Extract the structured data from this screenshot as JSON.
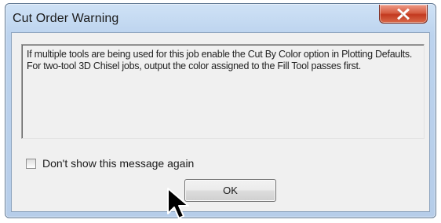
{
  "dialog": {
    "title": "Cut Order Warning",
    "close_icon": "close-icon",
    "close_button_color": "#d04a2f",
    "message": "If multiple tools are being used for this job enable the Cut By Color option in Plotting Defaults. For two-tool 3D Chisel jobs, output the color assigned to the Fill Tool passes first.",
    "checkbox": {
      "label": "Don't show this message again",
      "checked": false
    },
    "ok_label": "OK"
  },
  "cursor": {
    "icon": "mouse-pointer-icon"
  }
}
